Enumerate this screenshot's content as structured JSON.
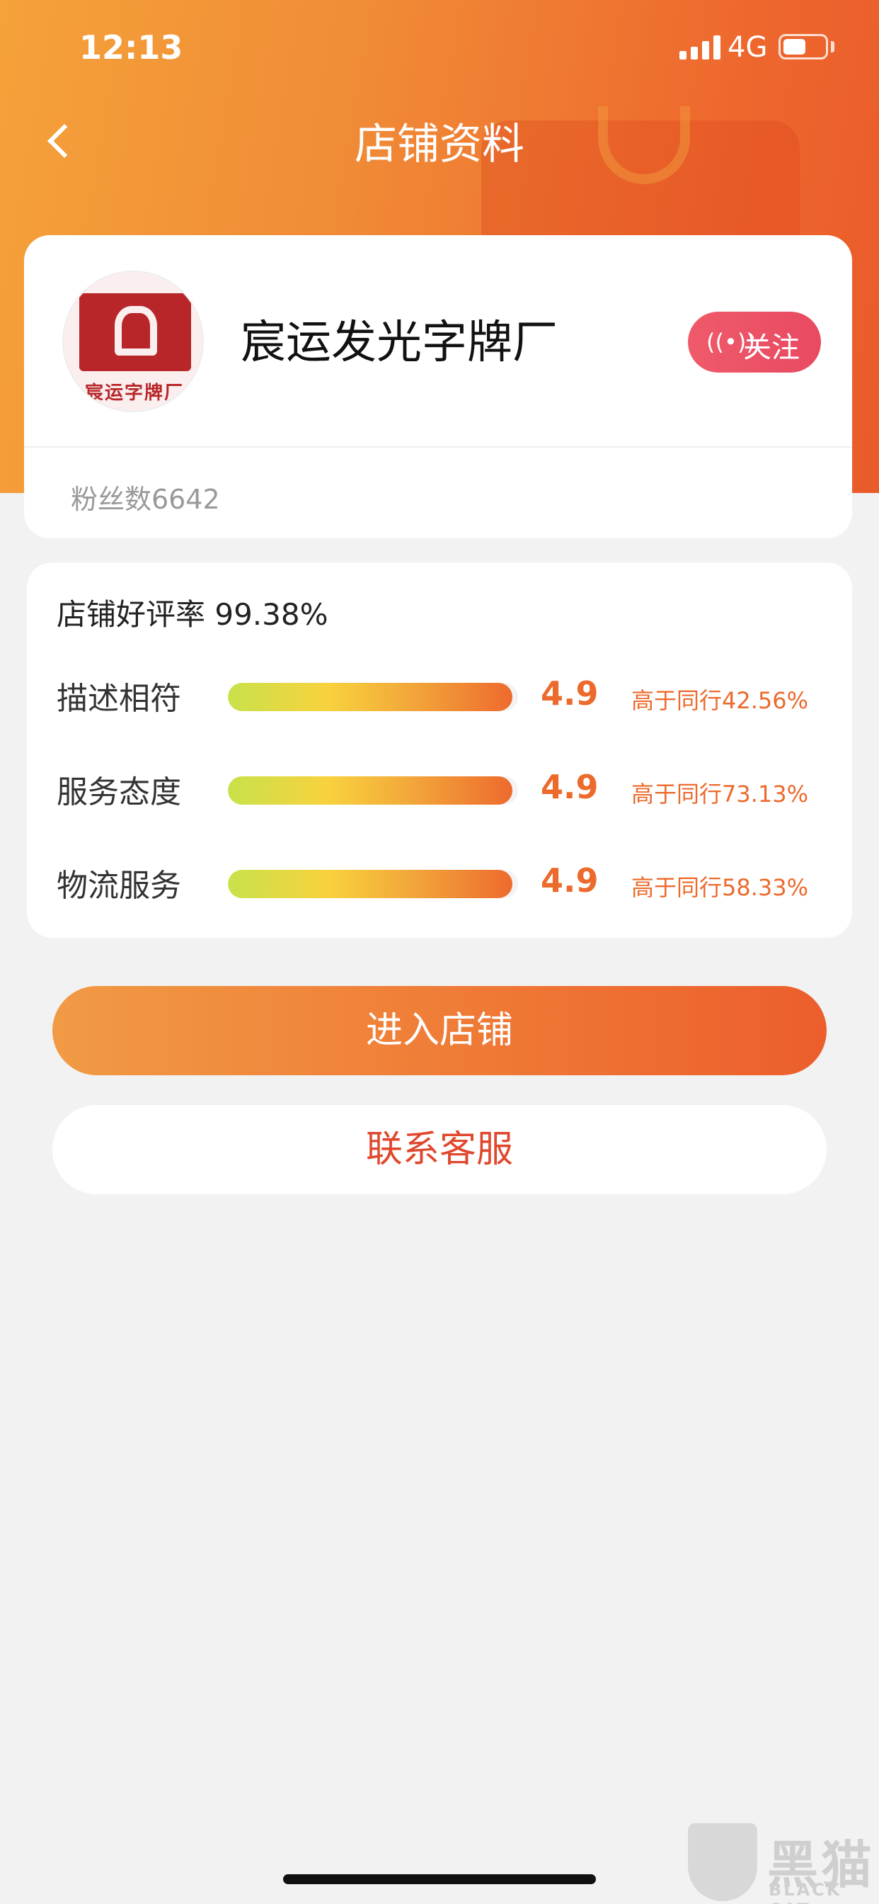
{
  "status_bar": {
    "time": "12:13",
    "network": "4G",
    "battery_level": 0.55
  },
  "nav": {
    "title": "店铺资料",
    "back_icon": "chevron-left-icon"
  },
  "store": {
    "name": "宸运发光字牌厂",
    "avatar_text": "宸运字牌厂",
    "follow_label": "关注",
    "follow_icon": "live-broadcast-icon",
    "fans": "粉丝数6642"
  },
  "ratings": {
    "good_rate": "店铺好评率 99.38%",
    "items": [
      {
        "label": "描述相符",
        "score": "4.9",
        "fill": 0.98,
        "compare": "高于同行42.56%"
      },
      {
        "label": "服务态度",
        "score": "4.9",
        "fill": 0.98,
        "compare": "高于同行73.13%"
      },
      {
        "label": "物流服务",
        "score": "4.9",
        "fill": 0.98,
        "compare": "高于同行58.33%"
      }
    ]
  },
  "actions": {
    "enter_store": "进入店铺",
    "contact_service": "联系客服"
  },
  "watermark": {
    "main": "黑猫",
    "sub": "BLACK CAT"
  },
  "colors": {
    "accent": "#ec6a2c",
    "follow": "#e84a62",
    "contact_text": "#e0482e"
  }
}
